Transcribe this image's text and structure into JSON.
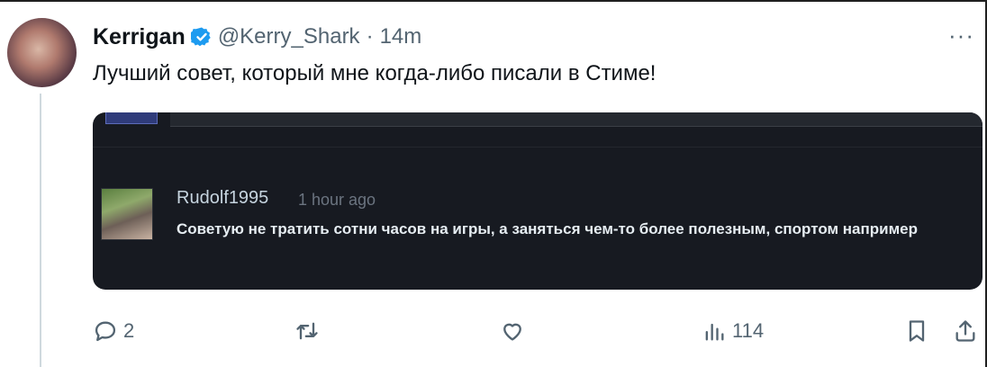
{
  "tweet": {
    "author_name": "Kerrigan",
    "author_handle": "@Kerry_Shark",
    "separator": "·",
    "time": "14m",
    "more": "···",
    "text": "Лучший совет, который мне когда-либо писали в Стиме!",
    "verified_icon": "verified-badge-icon"
  },
  "embedded_comment": {
    "username": "Rudolf1995",
    "time": "1 hour ago",
    "text": "Советую не тратить сотни часов на игры, а заняться чем-то более полезным, спортом например"
  },
  "actions": {
    "replies": "2",
    "views": "114"
  },
  "colors": {
    "accent": "#1d9bf0",
    "text": "#0f1419",
    "muted": "#536471",
    "card_bg": "#171a21"
  }
}
